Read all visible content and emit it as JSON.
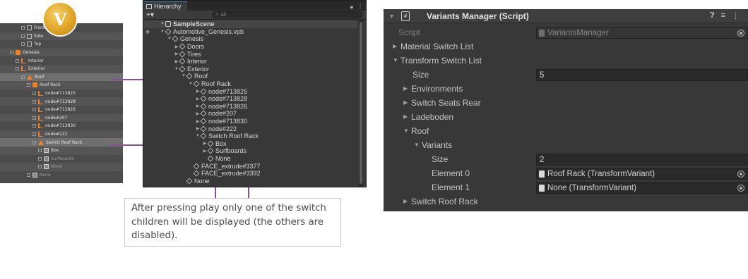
{
  "vred": {
    "rows": [
      {
        "label": "Front",
        "icon": "camera-icon",
        "indent": 3,
        "alt": false
      },
      {
        "label": "Side",
        "icon": "camera-icon",
        "indent": 3,
        "alt": true
      },
      {
        "label": "Top",
        "icon": "camera-icon",
        "indent": 3,
        "alt": false
      },
      {
        "label": "Genesis",
        "icon": "group-icon",
        "indent": 1,
        "alt": true
      },
      {
        "label": "Interior",
        "icon": "switch-icon",
        "indent": 2,
        "alt": false
      },
      {
        "label": "Exterior",
        "icon": "switch-icon",
        "indent": 2,
        "alt": true
      },
      {
        "label": "Roof",
        "icon": "transform-icon",
        "indent": 3,
        "alt": false,
        "selected": true
      },
      {
        "label": "Roof Rack",
        "icon": "group-icon",
        "indent": 4,
        "alt": true
      },
      {
        "label": "node#713825",
        "icon": "switch-icon",
        "indent": 5,
        "alt": false
      },
      {
        "label": "node#713828",
        "icon": "switch-icon",
        "indent": 5,
        "alt": true
      },
      {
        "label": "node#713826",
        "icon": "switch-icon",
        "indent": 5,
        "alt": false
      },
      {
        "label": "node#207",
        "icon": "switch-icon",
        "indent": 5,
        "alt": true
      },
      {
        "label": "node#713830",
        "icon": "switch-icon",
        "indent": 5,
        "alt": false
      },
      {
        "label": "node#222",
        "icon": "switch-icon",
        "indent": 5,
        "alt": true
      },
      {
        "label": "Switch Roof Rack",
        "icon": "transform-icon",
        "indent": 5,
        "alt": false,
        "selected": true
      },
      {
        "label": "Box",
        "icon": "geometry-icon",
        "indent": 6,
        "alt": true
      },
      {
        "label": "Surfboards",
        "icon": "geometry-icon",
        "indent": 6,
        "alt": false,
        "dim": true
      },
      {
        "label": "None",
        "icon": "geometry-icon",
        "indent": 6,
        "alt": true,
        "dim": true
      },
      {
        "label": "None",
        "icon": "geometry-icon",
        "indent": 4,
        "alt": false,
        "dim": true
      }
    ],
    "logo_letter": "V"
  },
  "hierarchy": {
    "tab_label": "Hierarchy",
    "add_label": "+▾",
    "search_placeholder": "All",
    "lock_icon": "lock-icon",
    "menu_dots": "⋮",
    "rows": [
      {
        "label": "SampleScene",
        "depth": 0,
        "arrow": "▼",
        "scene": true
      },
      {
        "label": "Automotive_Genesis.vpb",
        "depth": 1,
        "arrow": "▼"
      },
      {
        "label": "Genesis",
        "depth": 2,
        "arrow": "▼"
      },
      {
        "label": "Doors",
        "depth": 3,
        "arrow": "▶"
      },
      {
        "label": "Tires",
        "depth": 3,
        "arrow": "▶"
      },
      {
        "label": "Interior",
        "depth": 3,
        "arrow": "▶"
      },
      {
        "label": "Exterior",
        "depth": 3,
        "arrow": "▼"
      },
      {
        "label": "Roof",
        "depth": 4,
        "arrow": "▼"
      },
      {
        "label": "Roof Rack",
        "depth": 5,
        "arrow": "▼"
      },
      {
        "label": "node#713825",
        "depth": 6,
        "arrow": "▶"
      },
      {
        "label": "node#713828",
        "depth": 6,
        "arrow": "▶"
      },
      {
        "label": "node#713826",
        "depth": 6,
        "arrow": "▶"
      },
      {
        "label": "node#207",
        "depth": 6,
        "arrow": "▶"
      },
      {
        "label": "node#713830",
        "depth": 6,
        "arrow": "▶"
      },
      {
        "label": "node#222",
        "depth": 6,
        "arrow": "▶"
      },
      {
        "label": "Switch Roof Rack",
        "depth": 6,
        "arrow": "▼"
      },
      {
        "label": "Box",
        "depth": 7,
        "arrow": "▶"
      },
      {
        "label": "Surfboards",
        "depth": 7,
        "arrow": "▶"
      },
      {
        "label": "None",
        "depth": 7,
        "arrow": ""
      },
      {
        "label": "FACE_extrude#3377",
        "depth": 5,
        "arrow": ""
      },
      {
        "label": "FACE_extrude#3392",
        "depth": 5,
        "arrow": ""
      },
      {
        "label": "None",
        "depth": 4,
        "arrow": ""
      }
    ]
  },
  "callout": {
    "text": "After pressing play only one of the switch children will be displayed (the others are disabled)."
  },
  "inspector": {
    "title": "Variants Manager (Script)",
    "script_label": "Script",
    "script_value": "VariantsManager",
    "rows": [
      {
        "label": "Material Switch List",
        "arrow": "▶",
        "indent": 0
      },
      {
        "label": "Transform Switch List",
        "arrow": "▼",
        "indent": 0
      },
      {
        "label": "Size",
        "arrow": "",
        "indent": 1,
        "value": "5",
        "field": "int"
      },
      {
        "label": "Environments",
        "arrow": "▶",
        "indent": 1
      },
      {
        "label": "Switch Seats Rear",
        "arrow": "▶",
        "indent": 1
      },
      {
        "label": "Ladeboden",
        "arrow": "▶",
        "indent": 1
      },
      {
        "label": "Roof",
        "arrow": "▼",
        "indent": 1
      },
      {
        "label": "Variants",
        "arrow": "▼",
        "indent": 2
      },
      {
        "label": "Size",
        "arrow": "",
        "indent": 3,
        "value": "2",
        "field": "int"
      },
      {
        "label": "Element 0",
        "arrow": "",
        "indent": 3,
        "value": "Roof Rack (TransformVariant)",
        "field": "object"
      },
      {
        "label": "Element 1",
        "arrow": "",
        "indent": 3,
        "value": "None (TransformVariant)",
        "field": "object"
      },
      {
        "label": "Switch Roof Rack",
        "arrow": "▶",
        "indent": 1
      }
    ]
  }
}
